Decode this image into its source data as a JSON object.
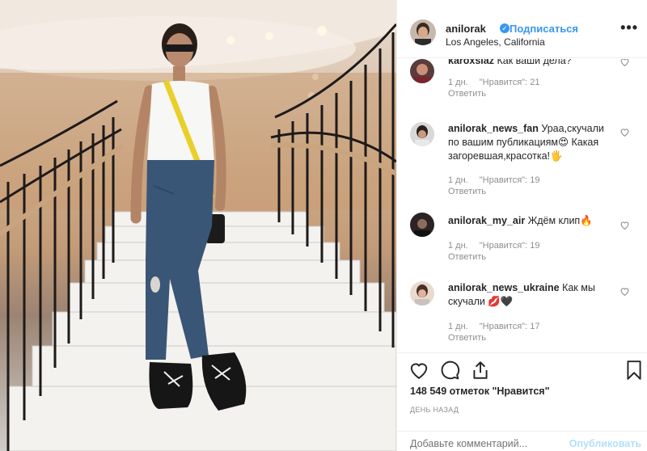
{
  "post": {
    "username": "anilorak",
    "follow_label": "Подписаться",
    "location": "Los Angeles, California",
    "more_label": "•••"
  },
  "comments": [
    {
      "user": "karoxsiaz",
      "text": "Как ваши дела?",
      "time": "1 дн.",
      "likes": "\"Нравится\": 21",
      "reply": "Ответить"
    },
    {
      "user": "anilorak_news_fan",
      "text": "Ураа,скучали по вашим публикациям😍 Какая загоревшая,красотка!🖐",
      "time": "1 дн.",
      "likes": "\"Нравится\": 19",
      "reply": "Ответить"
    },
    {
      "user": "anilorak_my_air",
      "text": "Ждём клип🔥",
      "time": "1 дн.",
      "likes": "\"Нравится\": 19",
      "reply": "Ответить"
    },
    {
      "user": "anilorak_news_ukraine",
      "text": "Как мы скучали 💋🖤",
      "time": "1 дн.",
      "likes": "\"Нравится\": 17",
      "reply": "Ответить"
    }
  ],
  "stats": {
    "likes": "148 549 отметок \"Нравится\"",
    "posted": "ДЕНЬ НАЗАД"
  },
  "comment_box": {
    "placeholder": "Добавьте комментарий...",
    "publish_label": "Опубликовать"
  },
  "colors": {
    "link": "#3897f0",
    "text": "#262626",
    "muted": "#8e8e8e",
    "border": "#efefef"
  }
}
